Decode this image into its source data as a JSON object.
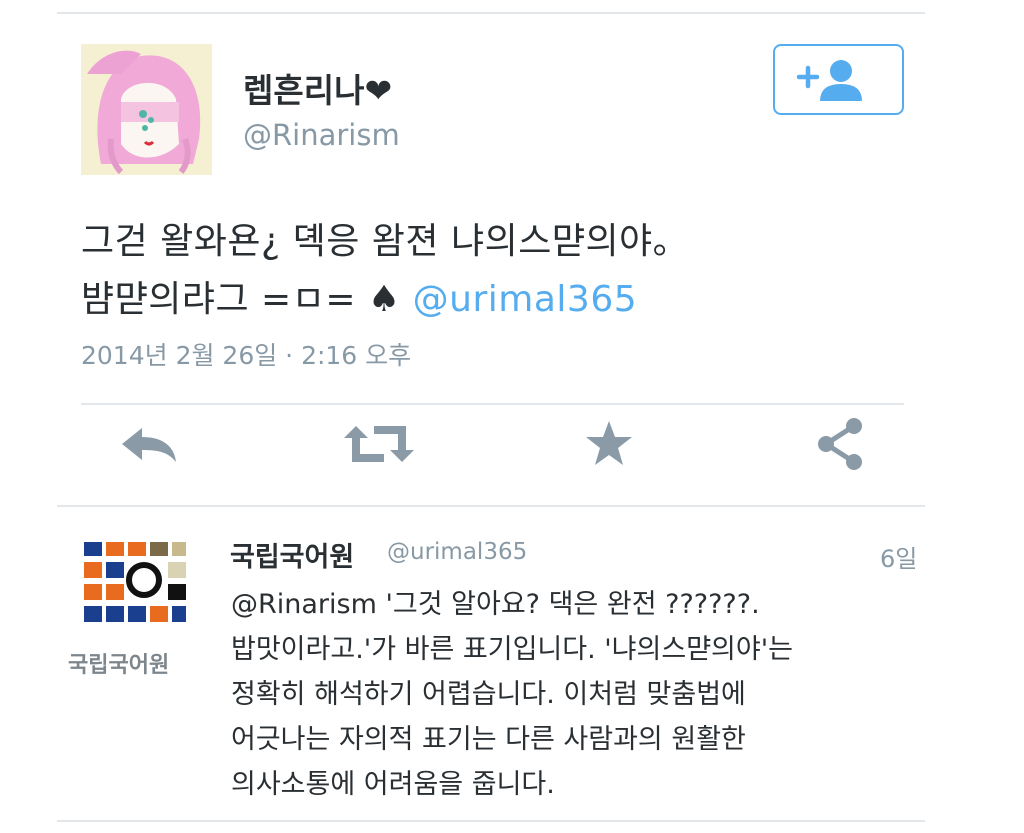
{
  "tweet": {
    "display_name": "렙흔리나❤",
    "handle": "@Rinarism",
    "text_line1": "그걷 왈와욘¿ 뎩응 왐젼 냐의스먇의야。",
    "text_line2_prefix": "뱜먇의랴그 =ㅁ= ♠",
    "text_line2_mention": "@urimal365",
    "timestamp": "2014년 2월 26일 · 2:16 오후",
    "follow_icon": "follow-plus-user-icon",
    "actions": [
      {
        "icon": "reply-icon"
      },
      {
        "icon": "retweet-icon"
      },
      {
        "icon": "favorite-star-icon"
      },
      {
        "icon": "share-icon"
      }
    ]
  },
  "reply": {
    "display_name": "국립국어원",
    "handle": "@urimal365",
    "time": "6일",
    "avatar_caption": "국립국어원",
    "lines": [
      "@Rinarism  '그것 알아요? 댁은 완전 ??????.",
      "밥맛이라고.'가 바른 표기입니다. '냐의스먇의야'는",
      "정확히 해석하기 어렵습니다. 이처럼 맞춤법에",
      "어긋나는 자의적 표기는 다른 사람과의 원활한",
      "의사소통에 어려움을 줍니다."
    ]
  },
  "colors": {
    "text": "#292f33",
    "muted": "#8899a6",
    "accent": "#55acee",
    "icon": "#8a9aa7",
    "divider": "#e3e7ea"
  }
}
